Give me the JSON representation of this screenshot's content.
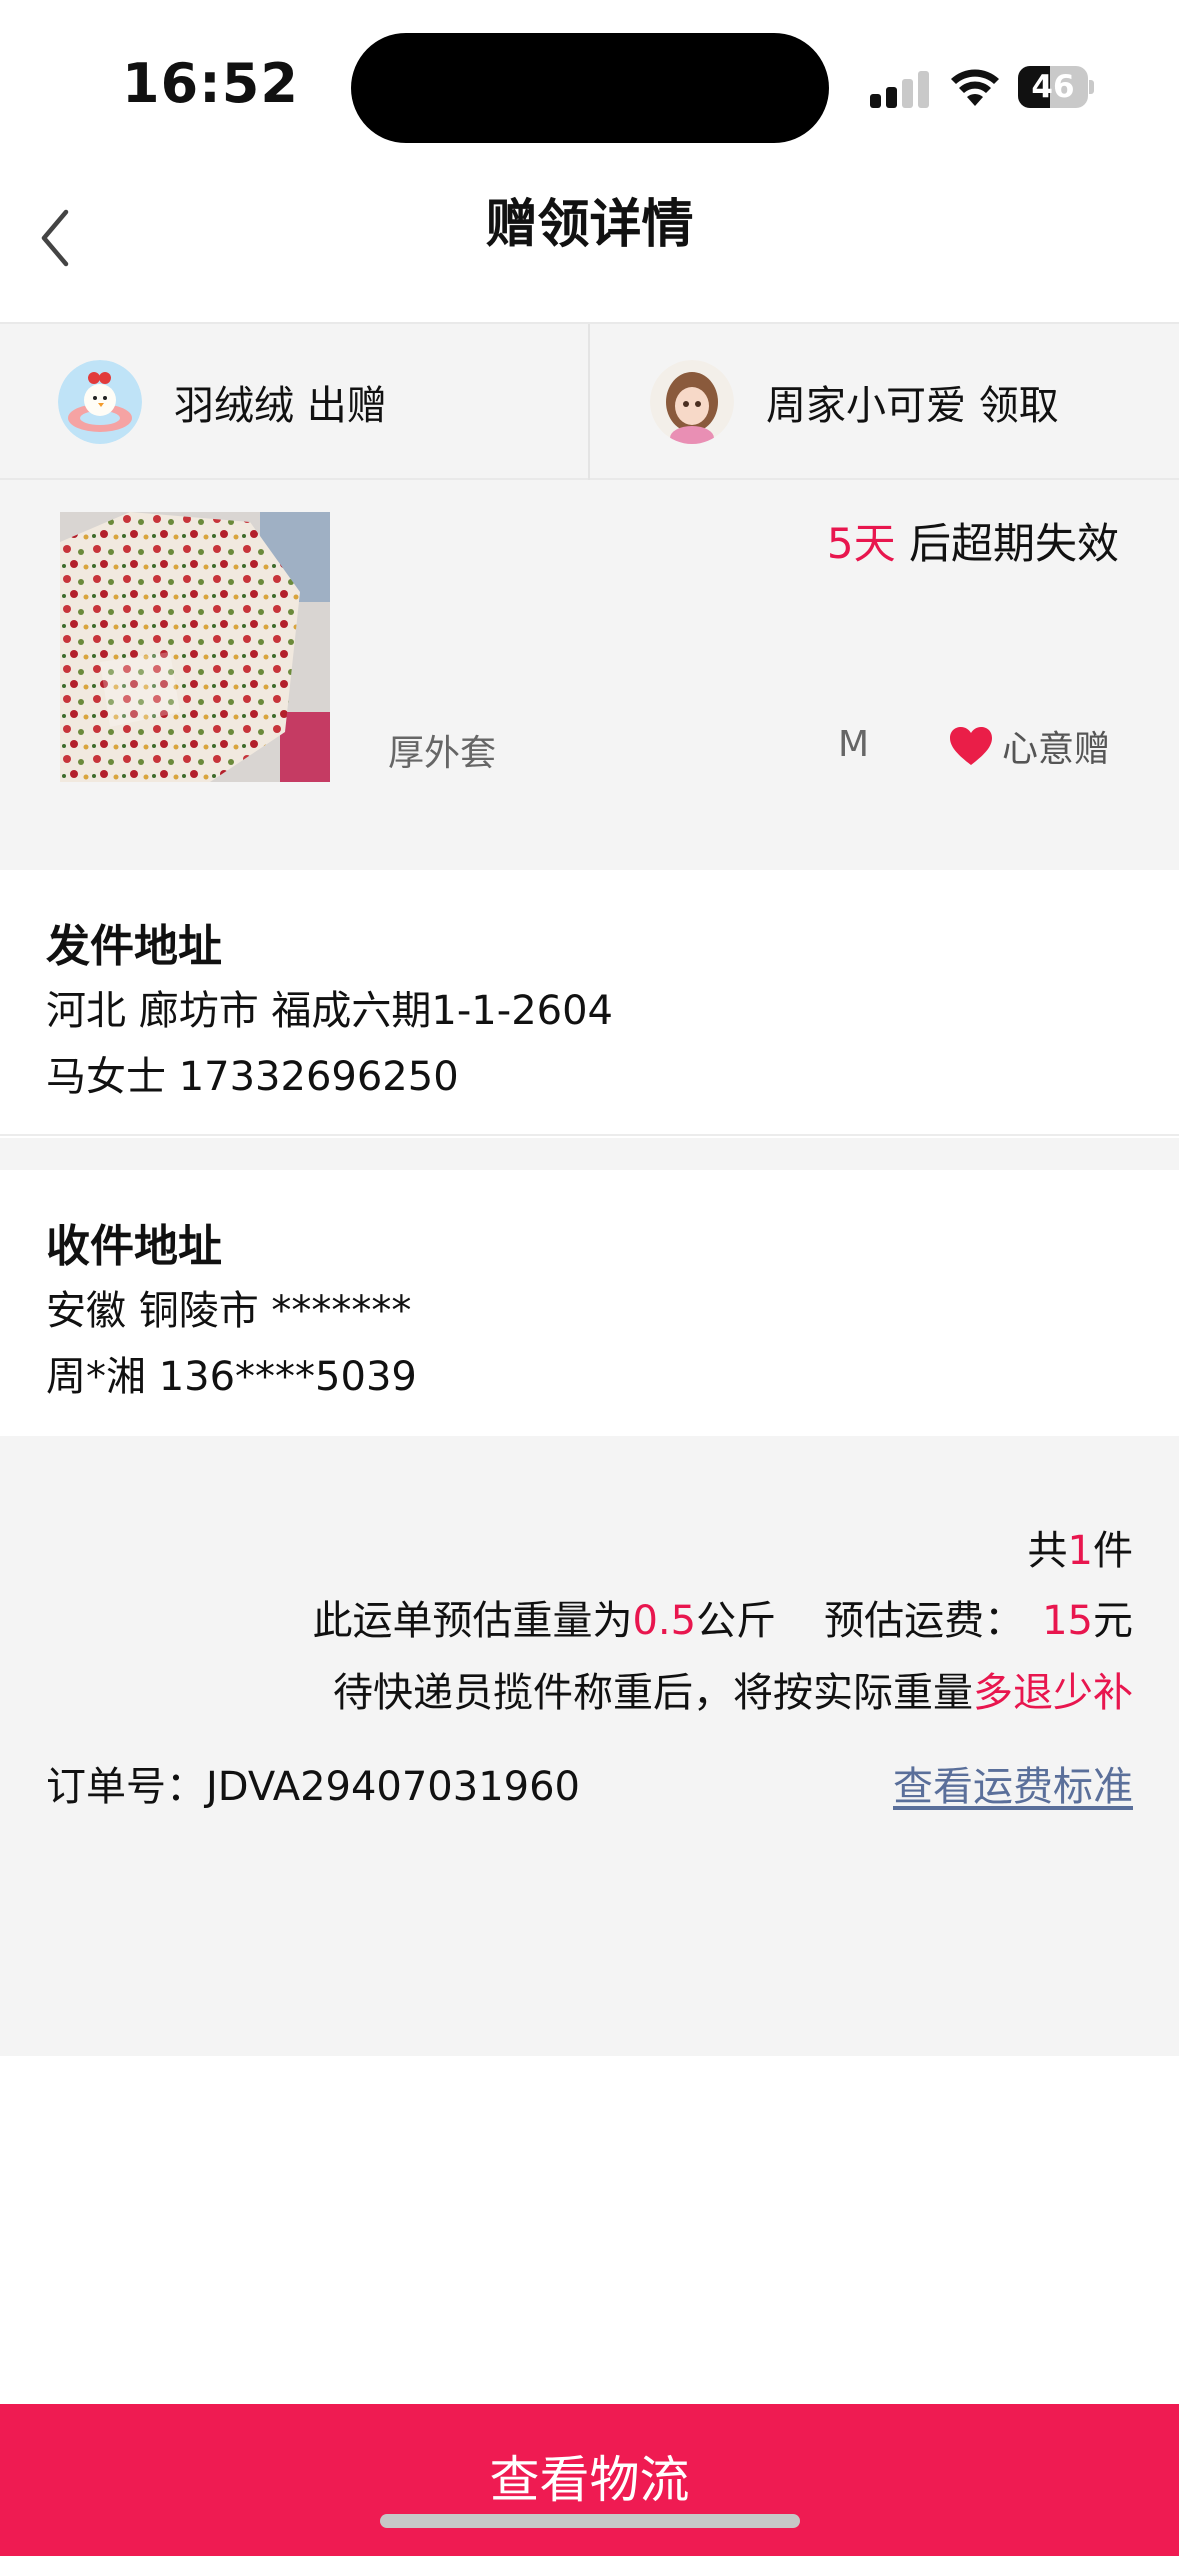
{
  "status_bar": {
    "time": "16:52",
    "battery_percent": "46",
    "battery_level": 0.46
  },
  "nav": {
    "title": "赠领详情",
    "back_icon": "chevron-left-icon"
  },
  "parties": {
    "giver": {
      "name": "羽绒绒 出赠",
      "avatar_icon": "chick-avatar"
    },
    "receiver": {
      "name": "周家小可爱 领取",
      "avatar_icon": "girl-avatar"
    }
  },
  "item": {
    "expire_days": "5天",
    "expire_suffix": " 后超期失效",
    "name": "厚外套",
    "size": "M",
    "gift_type": "心意赠",
    "gift_icon": "heart-icon"
  },
  "sender": {
    "title": "发件地址",
    "address": "河北 廊坊市 福成六期1-1-2604",
    "contact": "马女士 17332696250"
  },
  "receiver": {
    "title": "收件地址",
    "address": "安徽 铜陵市 *******",
    "contact": "周*湘 136****5039"
  },
  "summary": {
    "count_prefix": "共",
    "count": "1",
    "count_suffix": "件",
    "weight_prefix": "此运单预估重量为",
    "weight": "0.5",
    "weight_suffix": "公斤",
    "fee_prefix": "预估运费：",
    "fee": "15",
    "fee_suffix": "元",
    "note_prefix": "待快递员揽件称重后，将按实际重量",
    "note_highlight": "多退少补",
    "order_label": "订单号：",
    "order_number": "JDVA29407031960",
    "fee_standard_link": "查看运费标准"
  },
  "bottom": {
    "button_label": "查看物流"
  },
  "colors": {
    "accent": "#ef1b52",
    "highlight_text": "#e8164e",
    "link": "#5a6f9a",
    "section_bg": "#f4f4f4"
  }
}
